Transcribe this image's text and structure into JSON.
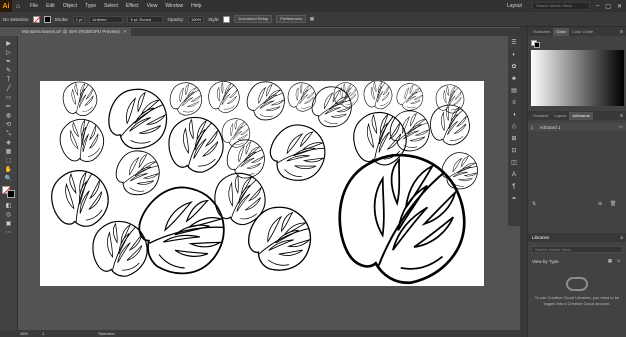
{
  "app": {
    "logo": "Ai",
    "home_icon": "home-icon"
  },
  "menu": [
    "File",
    "Edit",
    "Object",
    "Type",
    "Select",
    "Effect",
    "View",
    "Window",
    "Help"
  ],
  "menubar_right": {
    "layout": "Layout",
    "search_placeholder": "Search Adobe Stock"
  },
  "control_bar": {
    "selection": "No Selection",
    "stroke_label": "Stroke:",
    "stroke_value": "1 pt",
    "profile": "Uniform",
    "brush": "5 pt. Round",
    "opacity_label": "Opacity:",
    "opacity_value": "100%",
    "style_label": "Style:",
    "document_setup": "Document Setup",
    "preferences": "Preferences"
  },
  "doc_tab": {
    "title": "Monstera leaves.ai* @ 45% (RGB/GPU Preview)",
    "close": "×"
  },
  "tools": [
    "▶",
    "▷",
    "✒",
    "✎",
    "T",
    "╱",
    "▭",
    "✏",
    "◍",
    "⟲",
    "⤡",
    "◈",
    "▦",
    "⬚",
    "✋",
    "🔍"
  ],
  "panels": {
    "top_tabs": [
      "Swatches",
      "Color",
      "Color Guide"
    ],
    "mid_tabs": [
      "Gradient",
      "Layers",
      "Artboards"
    ],
    "artboards": [
      {
        "num": "1",
        "name": "Artboard 1"
      }
    ],
    "libraries": {
      "title": "Libraries",
      "search_placeholder": "Search Adobe Stock",
      "view_label": "View by Type",
      "message": "To use Creative Cloud Libraries, you need to be logged into a Creative Cloud account."
    }
  },
  "status": {
    "zoom": "45%",
    "artboard_num": "1",
    "tool_name": "Selection"
  },
  "colors": {
    "menubar": "#323232",
    "canvas": "#535353",
    "panel": "#424242"
  }
}
